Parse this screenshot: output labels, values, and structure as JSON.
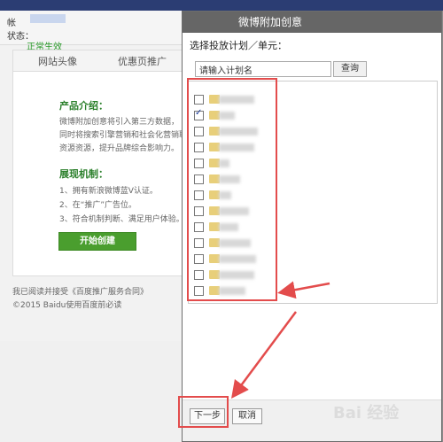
{
  "account": {
    "label1": "帐",
    "label2": "状态：",
    "status": "正常生效"
  },
  "tabs": [
    {
      "label": "网站头像"
    },
    {
      "label": "优惠页推广"
    }
  ],
  "intro": {
    "heading": "产品介绍：",
    "lines": [
      "微博附加创意将引入第三方数据，",
      "同时将搜索引擎营销和社会化营销联",
      "资源资源，提升品牌综合影响力。"
    ]
  },
  "display": {
    "heading": "展现机制：",
    "lines": [
      "1、拥有新浪微博蓝V认证。",
      "2、在“推广”广告位。",
      "3、符合机制判断、满足用户体验。"
    ]
  },
  "start_button": "开始创建",
  "page_footer": {
    "line1": "我已阅读并接受《百度推广服务合同》",
    "line2": "©2015 Baidu使用百度前必读"
  },
  "dialog": {
    "title": "微博附加创意",
    "subtitle": "选择投放计划／单元：",
    "search_placeholder": "请输入计划名",
    "search_button": "查询",
    "items": [
      {
        "checked": false
      },
      {
        "checked": true
      },
      {
        "checked": false
      },
      {
        "checked": false
      },
      {
        "checked": false
      },
      {
        "checked": false
      },
      {
        "checked": false
      },
      {
        "checked": false
      },
      {
        "checked": false
      },
      {
        "checked": false
      },
      {
        "checked": false
      },
      {
        "checked": false
      },
      {
        "checked": false
      }
    ],
    "next_button": "下一步",
    "cancel_button": "取消"
  },
  "watermark": "Bai 经验",
  "colors": {
    "annotation_red": "#e34c4c",
    "start_green": "#4a9e2e",
    "status_green": "#2a9a2a"
  }
}
